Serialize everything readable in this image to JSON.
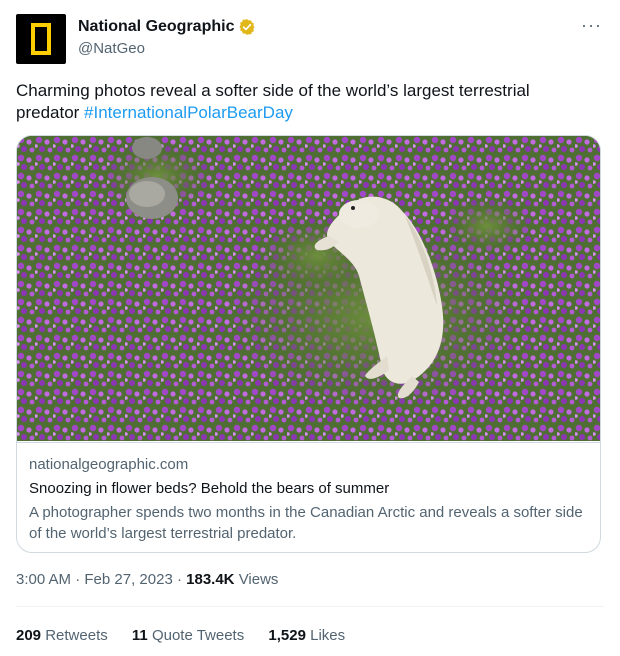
{
  "account": {
    "display_name": "National Geographic",
    "handle": "@NatGeo",
    "verified_badge_icon": "gold-verified-badge-icon",
    "avatar_icon": "natgeo-yellow-frame-logo"
  },
  "more_icon": "more-options-icon",
  "tweet": {
    "text": "Charming photos reveal a softer side of the world’s largest terrestrial predator ",
    "hashtag": "#InternationalPolarBearDay"
  },
  "card": {
    "image_icon": "polar-bear-in-flowers-photo",
    "domain": "nationalgeographic.com",
    "title": "Snoozing in flower beds? Behold the bears of summer",
    "description": "A photographer spends two months in the Canadian Arctic and reveals a softer side of the world’s largest terrestrial predator."
  },
  "meta": {
    "time": "3:00 AM",
    "separator": "·",
    "date": "Feb 27, 2023",
    "views_count": "183.4K",
    "views_label": "Views"
  },
  "stats": {
    "retweets_count": "209",
    "retweets_label": "Retweets",
    "quotes_count": "11",
    "quotes_label": "Quote Tweets",
    "likes_count": "1,529",
    "likes_label": "Likes"
  },
  "colors": {
    "link": "#1d9bf0",
    "secondary_text": "#536471",
    "badge_gold": "#e2b719",
    "natgeo_yellow": "#ffce00"
  }
}
